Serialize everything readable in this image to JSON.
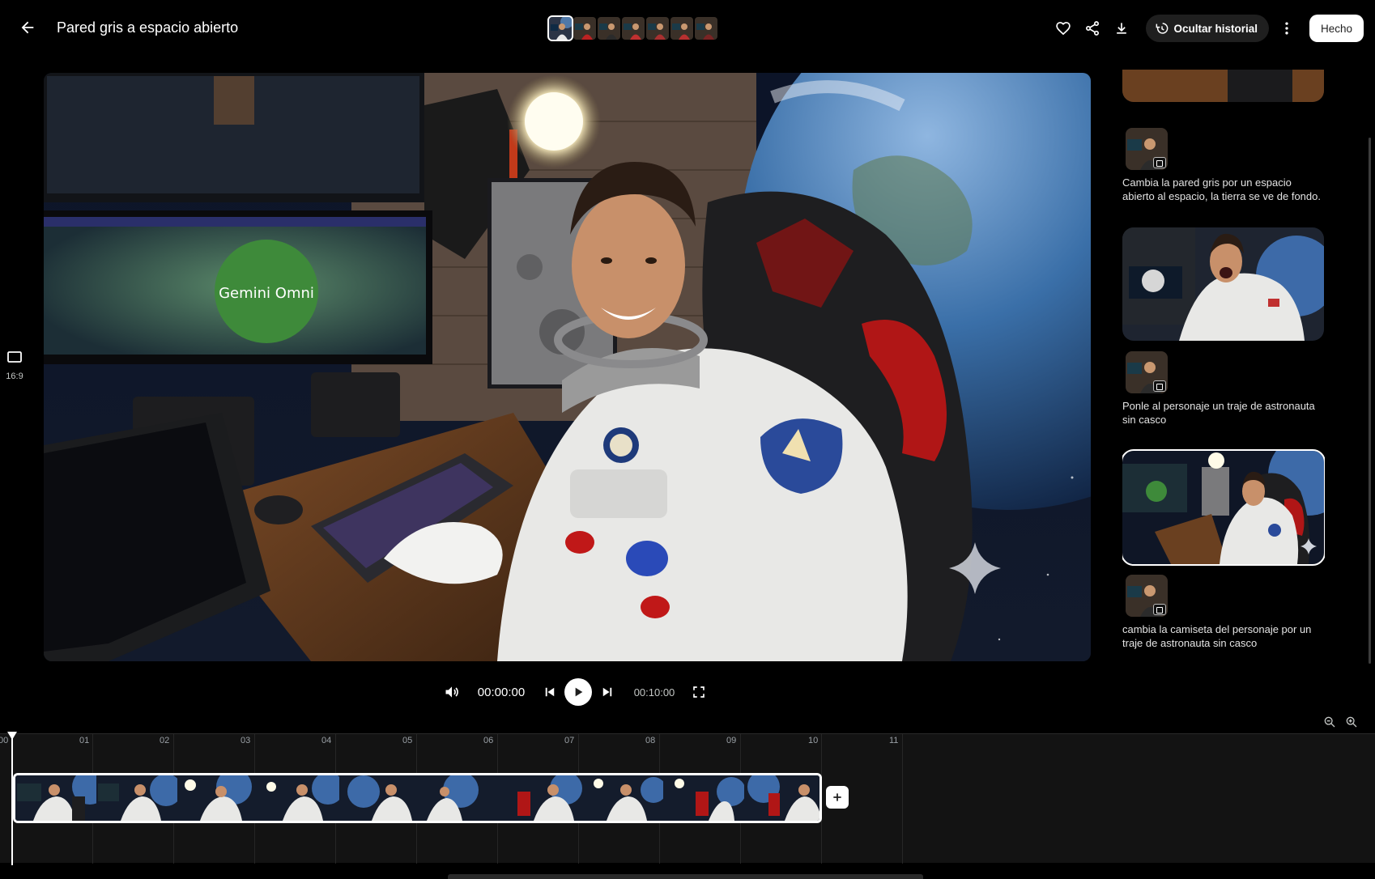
{
  "header": {
    "title": "Pared gris a espacio abierto",
    "hide_history_label": "Ocultar historial",
    "done_label": "Hecho",
    "thumbnails": [
      "version-1",
      "version-2",
      "version-3",
      "version-4",
      "version-5",
      "version-6",
      "version-7"
    ],
    "icons": [
      "back-arrow-icon",
      "heart-icon",
      "share-icon",
      "download-icon",
      "history-icon",
      "more-vert-icon"
    ]
  },
  "aspect": {
    "label": "16:9",
    "icon": "aspect-ratio-icon"
  },
  "history": {
    "entries": [
      {
        "prompt": "Cambia la pared gris por un espacio abierto al espacio, la tierra se ve de fondo."
      },
      {
        "prompt": "Ponle al personaje un traje de astronauta sin casco"
      },
      {
        "prompt": "cambia la camiseta del personaje por un traje de astronauta sin casco"
      }
    ]
  },
  "player": {
    "current_time": "00:00:00",
    "duration": "00:10:00",
    "icons": [
      "volume-icon",
      "skip-previous-icon",
      "play-icon",
      "skip-next-icon",
      "fullscreen-icon"
    ]
  },
  "timeline": {
    "ticks": [
      "00",
      "01",
      "02",
      "03",
      "04",
      "05",
      "06",
      "07",
      "08",
      "09",
      "10",
      "11"
    ],
    "icons": [
      "zoom-out-icon",
      "zoom-in-icon",
      "add-clip-icon"
    ],
    "playhead_position_seconds": 0
  },
  "colors": {
    "background": "#000000",
    "accent": "#ffffff",
    "panel": "#1f1f1f"
  }
}
